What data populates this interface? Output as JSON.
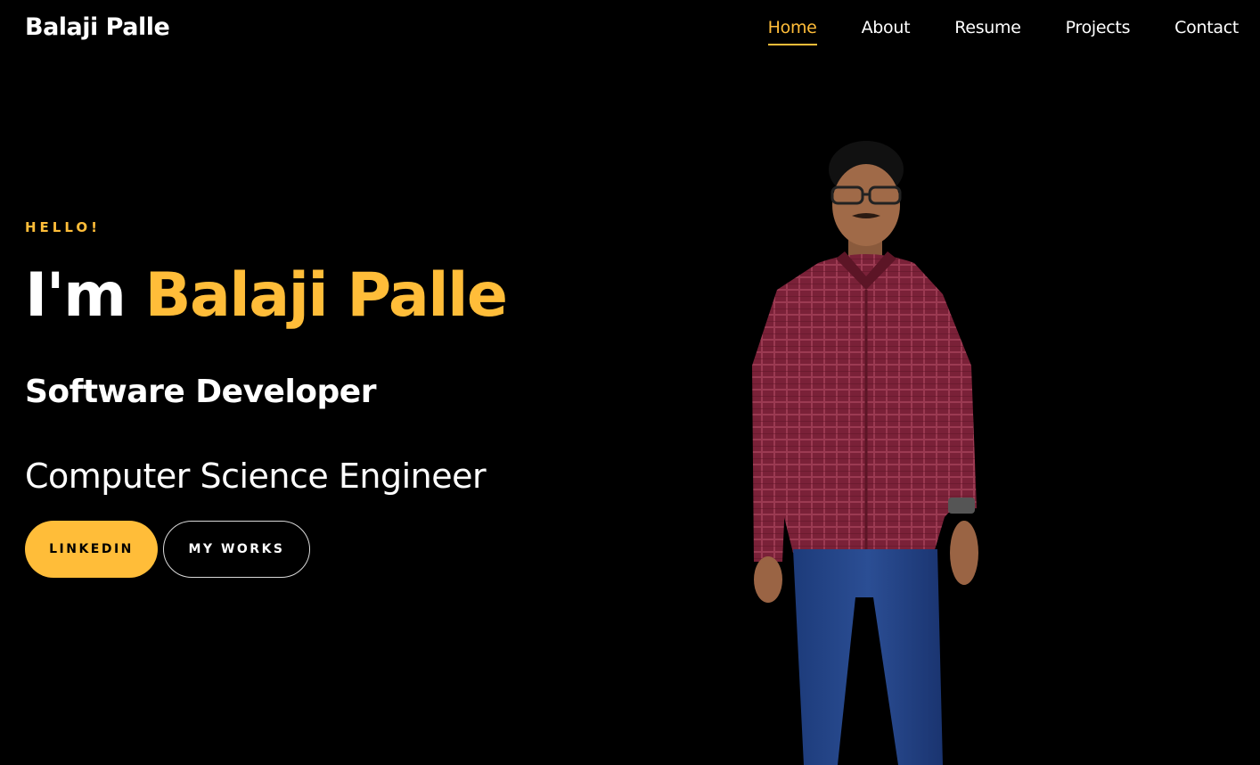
{
  "header": {
    "brand": "Balaji Palle",
    "nav": [
      {
        "label": "Home",
        "active": true
      },
      {
        "label": "About",
        "active": false
      },
      {
        "label": "Resume",
        "active": false
      },
      {
        "label": "Projects",
        "active": false
      },
      {
        "label": "Contact",
        "active": false
      }
    ]
  },
  "hero": {
    "greeting": "HELLO!",
    "title_prefix": "I'm",
    "title_name": "Balaji Palle",
    "role": "Software Developer",
    "subtitle": "Computer Science Engineer",
    "buttons": {
      "primary": "LINKEDIN",
      "secondary": "MY WORKS"
    }
  },
  "colors": {
    "background": "#000000",
    "accent": "#ffbd39",
    "text": "#ffffff"
  },
  "image": {
    "subject": "person-photo"
  }
}
